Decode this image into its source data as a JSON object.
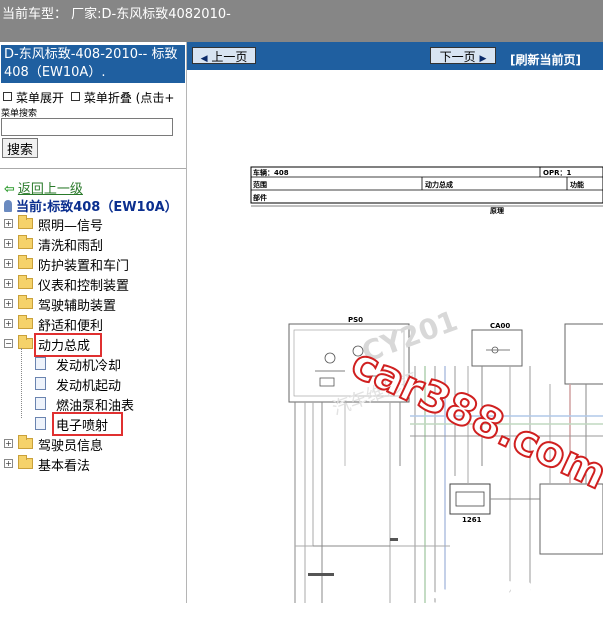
{
  "topbar": {
    "current_model": "当前车型：  厂家:D-东风标致4082010-"
  },
  "sidebar": {
    "title": "D-东风标致-408-2010-- 标致408（EW10A）.",
    "menu_expand": "菜单展开",
    "menu_collapse": "菜单折叠 (点击+",
    "search_label": "菜单搜索",
    "search_value": "",
    "search_button": "搜索",
    "back_link": "返回上一级",
    "current": "当前:标致408（EW10A）",
    "items": [
      {
        "label": "照明—信号"
      },
      {
        "label": "清洗和雨刮"
      },
      {
        "label": "防护装置和车门"
      },
      {
        "label": "仪表和控制装置"
      },
      {
        "label": "驾驶辅助装置"
      },
      {
        "label": "舒适和便利"
      },
      {
        "label": "动力总成"
      },
      {
        "label": "驾驶员信息"
      },
      {
        "label": "基本看法"
      }
    ],
    "children": [
      {
        "label": "发动机冷却"
      },
      {
        "label": "发动机起动"
      },
      {
        "label": "燃油泵和油表"
      },
      {
        "label": "电子喷射"
      }
    ]
  },
  "toolbar": {
    "prev_label": "上一页",
    "next_label": "下一页",
    "refresh_label": "[刷新当前页]"
  },
  "diagram": {
    "vehicle": "车辆：408",
    "opr": "OPR：1",
    "scope": "范围",
    "powertrain": "动力总成",
    "function": "功能",
    "part": "部件",
    "principle": "原理",
    "ps_label": "PS0",
    "ca_label": "CA00",
    "code_1261": "1261"
  },
  "watermark": {
    "site": "car388.com",
    "faint": "CY201",
    "faint2": "汽车维修平",
    "bottom": "汽车维修平"
  },
  "colors": {
    "topbar": "#868686",
    "title_bg": "#1f5fa0",
    "highlight": "#e03030"
  }
}
